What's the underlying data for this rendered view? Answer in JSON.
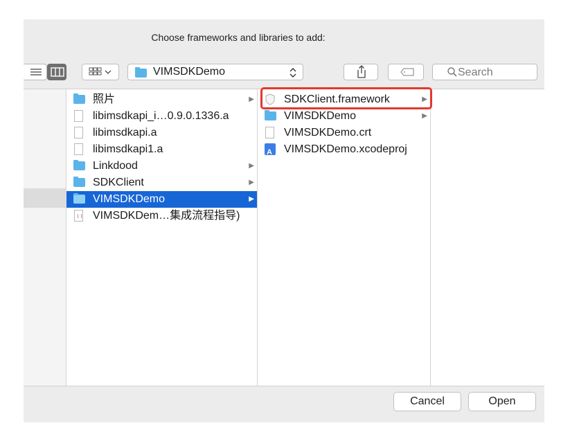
{
  "dialog": {
    "title": "Choose frameworks and libraries to add:"
  },
  "toolbar": {
    "view_list_icon": "list-view-icon",
    "view_column_icon": "column-view-icon",
    "group_icon": "grid-group-icon",
    "path_popup_label": "VIMSDKDemo",
    "share_icon": "share-icon",
    "tag_icon": "tag-icon",
    "search_placeholder": "Search"
  },
  "column1": {
    "items": [
      {
        "label": "照片",
        "icon": "folder-icon",
        "has_children": true,
        "arrow": "▶"
      },
      {
        "label": "libimsdkapi_i…0.9.0.1336.a",
        "icon": "file-icon",
        "has_children": false,
        "arrow": ""
      },
      {
        "label": "libimsdkapi.a",
        "icon": "file-icon",
        "has_children": false,
        "arrow": ""
      },
      {
        "label": "libimsdkapi1.a",
        "icon": "file-icon",
        "has_children": false,
        "arrow": ""
      },
      {
        "label": "Linkdood",
        "icon": "folder-icon",
        "has_children": true,
        "arrow": "▶"
      },
      {
        "label": "SDKClient",
        "icon": "folder-icon",
        "has_children": true,
        "arrow": "▶"
      },
      {
        "label": "VIMSDKDemo",
        "icon": "folder-icon",
        "has_children": true,
        "arrow": "▶",
        "selected": true
      },
      {
        "label": "VIMSDKDem…集成流程指导)",
        "icon": "rtf-document-icon",
        "has_children": false,
        "arrow": ""
      }
    ]
  },
  "column2": {
    "items": [
      {
        "label": "SDKClient.framework",
        "icon": "framework-icon",
        "arrow": "▶",
        "highlighted": true
      },
      {
        "label": "VIMSDKDemo",
        "icon": "folder-icon",
        "arrow": "▶"
      },
      {
        "label": "VIMSDKDemo.crt",
        "icon": "file-icon",
        "arrow": ""
      },
      {
        "label": "VIMSDKDemo.xcodeproj",
        "icon": "xcodeproj-icon",
        "arrow": ""
      }
    ]
  },
  "buttons": {
    "cancel": "Cancel",
    "open": "Open"
  },
  "colors": {
    "selection": "#1766d6",
    "highlight_border": "#e3382d",
    "folder": "#5ab4ea",
    "dialog_bg": "#ececec"
  }
}
